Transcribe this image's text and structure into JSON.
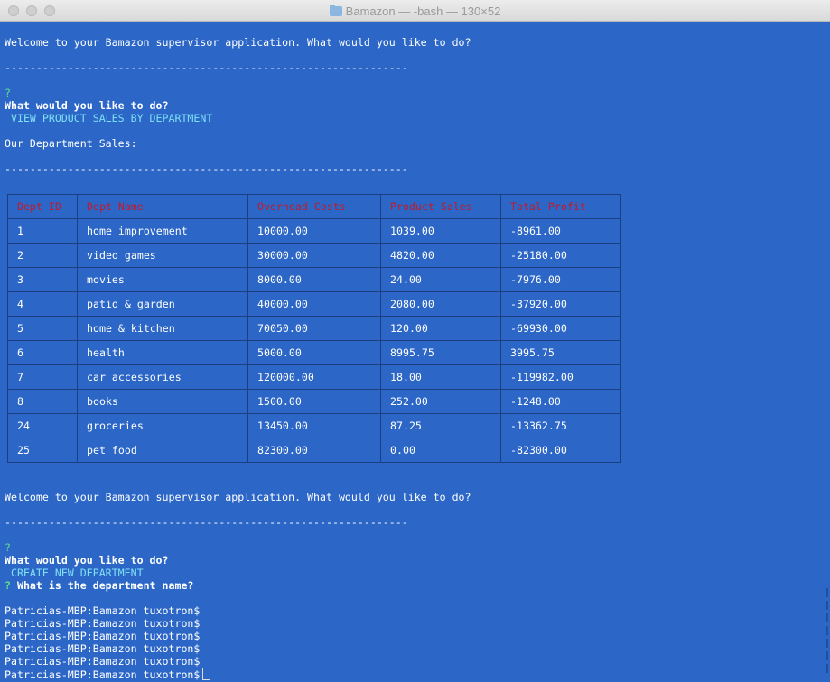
{
  "window": {
    "title": "Bamazon — -bash — 130×52"
  },
  "terminal": {
    "welcome_1": "Welcome to your Bamazon supervisor application. What would you like to do?",
    "divider_1": "----------------------------------------------------------------",
    "prompt_mark_1": "?",
    "question_1": "What would you like to do?",
    "answer_1": " VIEW PRODUCT SALES BY DEPARTMENT",
    "sales_heading": "Our Department Sales:",
    "divider_2": "----------------------------------------------------------------",
    "table": {
      "headers": [
        "Dept ID",
        "Dept Name",
        "Overhead Costs",
        "Product Sales",
        "Total Profit"
      ],
      "rows": [
        [
          "1",
          "home improvement",
          "10000.00",
          "1039.00",
          "-8961.00"
        ],
        [
          "2",
          "video games",
          "30000.00",
          "4820.00",
          "-25180.00"
        ],
        [
          "3",
          "movies",
          "8000.00",
          "24.00",
          "-7976.00"
        ],
        [
          "4",
          "patio & garden",
          "40000.00",
          "2080.00",
          "-37920.00"
        ],
        [
          "5",
          "home & kitchen",
          "70050.00",
          "120.00",
          "-69930.00"
        ],
        [
          "6",
          "health",
          "5000.00",
          "8995.75",
          "3995.75"
        ],
        [
          "7",
          "car accessories",
          "120000.00",
          "18.00",
          "-119982.00"
        ],
        [
          "8",
          "books",
          "1500.00",
          "252.00",
          "-1248.00"
        ],
        [
          "24",
          "groceries",
          "13450.00",
          "87.25",
          "-13362.75"
        ],
        [
          "25",
          "pet food",
          "82300.00",
          "0.00",
          "-82300.00"
        ]
      ]
    },
    "welcome_2": "Welcome to your Bamazon supervisor application. What would you like to do?",
    "divider_3": "----------------------------------------------------------------",
    "prompt_mark_2": "?",
    "question_2": "What would you like to do?",
    "answer_2": " CREATE NEW DEPARTMENT",
    "prompt_mark_3": "?",
    "question_3": " What is the department name?",
    "shell_prompts": [
      "Patricias-MBP:Bamazon tuxotron$",
      "Patricias-MBP:Bamazon tuxotron$",
      "Patricias-MBP:Bamazon tuxotron$",
      "Patricias-MBP:Bamazon tuxotron$",
      "Patricias-MBP:Bamazon tuxotron$",
      "Patricias-MBP:Bamazon tuxotron$"
    ]
  },
  "colors": {
    "background": "#2c67c7",
    "header_text": "#c21a2a",
    "answer_text": "#7fe0f5",
    "prompt_mark": "#5fe08a"
  }
}
